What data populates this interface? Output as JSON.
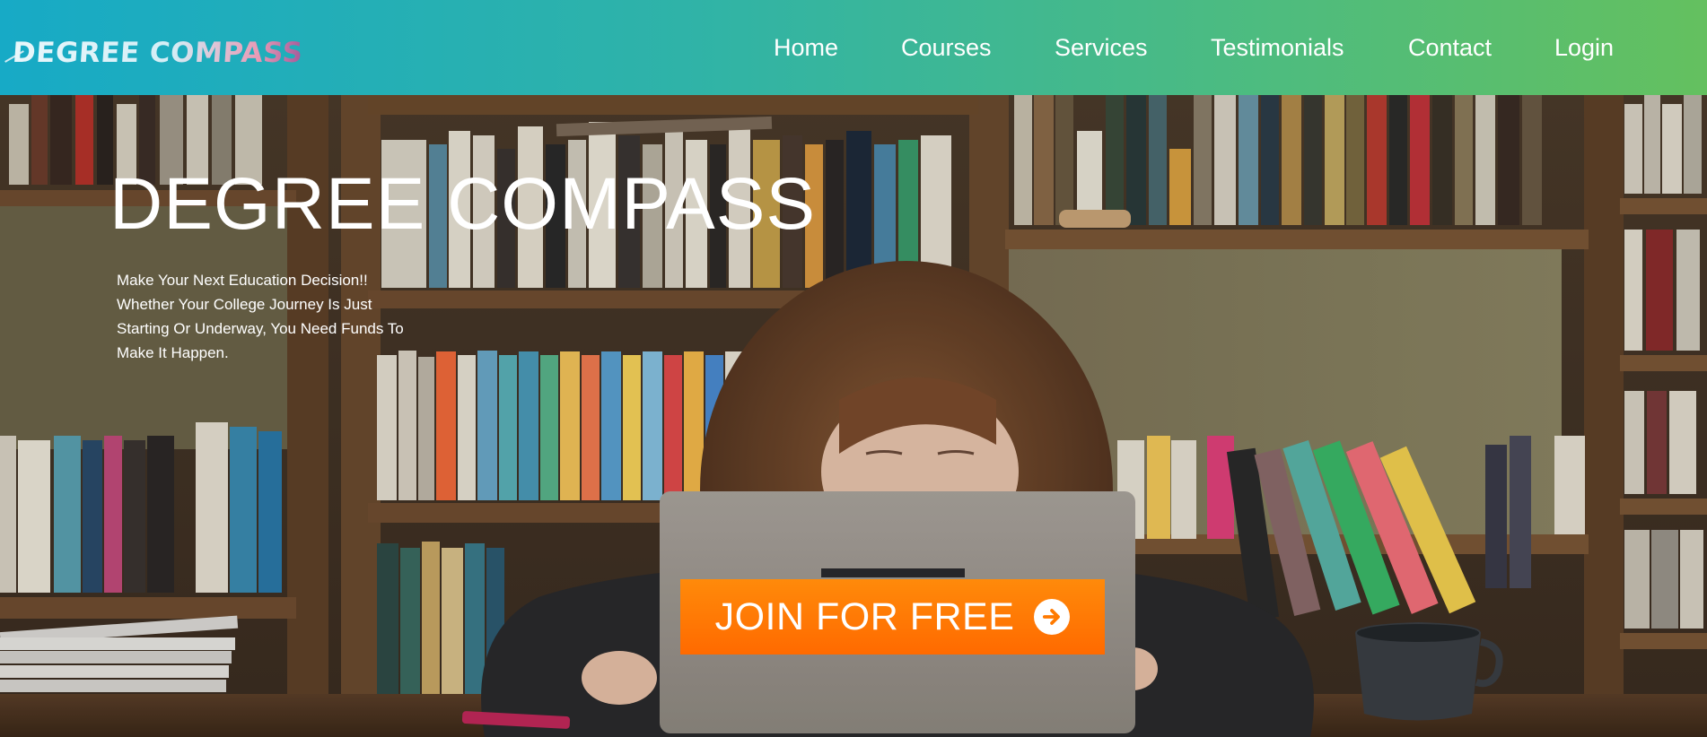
{
  "header": {
    "logo_text": "DEGREE COMPASS",
    "nav": [
      "Home",
      "Courses",
      "Services",
      "Testimonials",
      "Contact",
      "Login"
    ]
  },
  "hero": {
    "title": "DEGREE COMPASS",
    "subtitle": "Make Your Next Education Decision!! Whether Your College Journey Is Just Starting Or Underway, You Need Funds To Make It Happen.",
    "cta_label": "JOIN FOR FREE",
    "cta_icon": "arrow-right-circle-icon",
    "background_image": "student-with-laptop-in-front-of-bookshelves"
  },
  "colors": {
    "header_gradient_start": "#17aac6",
    "header_gradient_end": "#64c05f",
    "cta": "#ff7a00",
    "text": "#ffffff"
  }
}
